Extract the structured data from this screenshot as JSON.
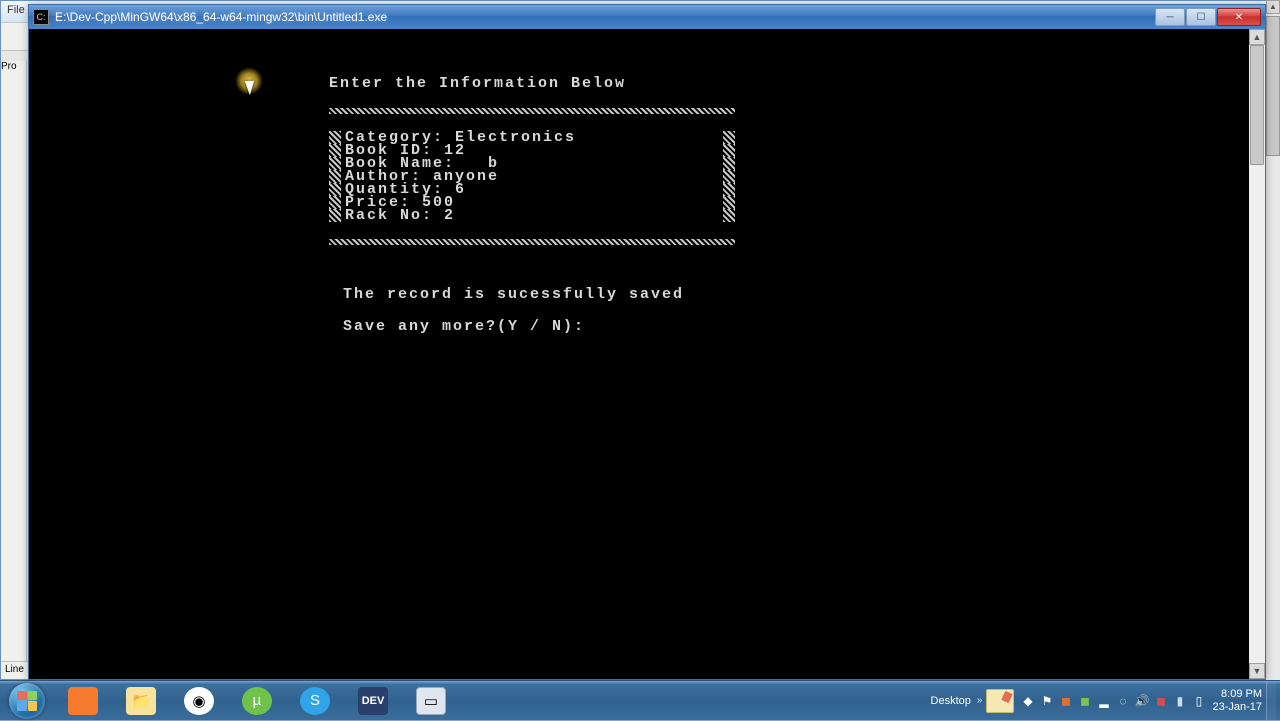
{
  "back_window": {
    "menu_hint": "File",
    "panel_hint": "Pro",
    "status_hint": "Line"
  },
  "window": {
    "title": "E:\\Dev-Cpp\\MinGW64\\x86_64-w64-mingw32\\bin\\Untitled1.exe"
  },
  "console": {
    "header": "Enter the Information Below",
    "fields": {
      "category": {
        "label": "Category:",
        "value": "Electronics"
      },
      "book_id": {
        "label": "Book ID:",
        "value": "12"
      },
      "book_name": {
        "label": "Book Name:",
        "value": "b"
      },
      "author": {
        "label": "Author:",
        "value": "anyone"
      },
      "quantity": {
        "label": "Quantity:",
        "value": "6"
      },
      "price": {
        "label": "Price:",
        "value": "500"
      },
      "rack_no": {
        "label": "Rack No:",
        "value": "2"
      }
    },
    "success_msg": "The record is sucessfully saved",
    "prompt": "Save any more?(Y / N):"
  },
  "taskbar": {
    "desktop_label": "Desktop",
    "clock_time": "8:09 PM",
    "clock_date": "23-Jan-17"
  }
}
